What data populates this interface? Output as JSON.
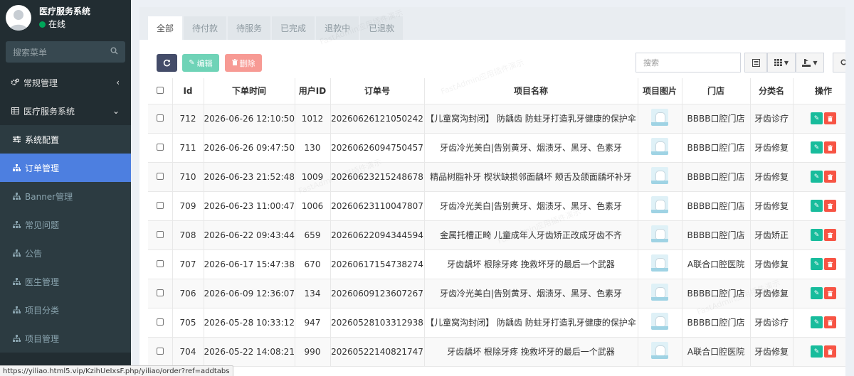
{
  "user": {
    "name": "医疗服务系统",
    "status": "在线"
  },
  "sidebar": {
    "search_placeholder": "搜索菜单",
    "items": [
      {
        "label": "常规管理",
        "icon": "cogs-icon"
      },
      {
        "label": "医疗服务系统",
        "icon": "table-icon"
      },
      {
        "label": "系统配置",
        "icon": "sliders-icon"
      },
      {
        "label": "订单管理",
        "icon": "sitemap-icon"
      },
      {
        "label": "Banner管理",
        "icon": "sitemap-icon"
      },
      {
        "label": "常见问题",
        "icon": "sitemap-icon"
      },
      {
        "label": "公告",
        "icon": "sitemap-icon"
      },
      {
        "label": "医生管理",
        "icon": "sitemap-icon"
      },
      {
        "label": "项目分类",
        "icon": "sitemap-icon"
      },
      {
        "label": "项目管理",
        "icon": "sitemap-icon"
      }
    ]
  },
  "tabs": [
    "全部",
    "待付款",
    "待服务",
    "已完成",
    "退款中",
    "已退款"
  ],
  "toolbar": {
    "edit_label": "编辑",
    "delete_label": "删除",
    "search_placeholder": "搜索"
  },
  "table": {
    "headers": [
      "Id",
      "下单时间",
      "用户ID",
      "订单号",
      "项目名称",
      "项目图片",
      "门店",
      "分类名",
      "操作"
    ],
    "rows": [
      {
        "id": "712",
        "time": "2026-06-26 12:10:50",
        "uid": "1012",
        "order_no": "20260626121050242",
        "project": "【儿童窝沟封闭】 防龋齿 防蛀牙打造乳牙健康的保护伞",
        "store": "BBBB口腔门店",
        "category": "牙齿诊疗"
      },
      {
        "id": "711",
        "time": "2026-06-26 09:47:50",
        "uid": "130",
        "order_no": "20260626094750457",
        "project": "牙齿冷光美白|告别黄牙、烟渍牙、黑牙、色素牙",
        "store": "BBBB口腔门店",
        "category": "牙齿修复"
      },
      {
        "id": "710",
        "time": "2026-06-23 21:52:48",
        "uid": "1009",
        "order_no": "20260623215248678",
        "project": "精品树脂补牙 楔状缺损邻面龋坏 颊舌及颌面龋坏补牙",
        "store": "BBBB口腔门店",
        "category": "牙齿修复"
      },
      {
        "id": "709",
        "time": "2026-06-23 11:00:47",
        "uid": "1006",
        "order_no": "20260623110047807",
        "project": "牙齿冷光美白|告别黄牙、烟渍牙、黑牙、色素牙",
        "store": "BBBB口腔门店",
        "category": "牙齿修复"
      },
      {
        "id": "708",
        "time": "2026-06-22 09:43:44",
        "uid": "659",
        "order_no": "20260622094344594",
        "project": "金属托槽正畸 儿童成年人牙齿矫正改成牙齿不齐",
        "store": "BBBB口腔门店",
        "category": "牙齿矫正"
      },
      {
        "id": "707",
        "time": "2026-06-17 15:47:38",
        "uid": "670",
        "order_no": "20260617154738274",
        "project": "牙齿龋坏 根除牙疼 挽救坏牙的最后一个武器",
        "store": "A联合口腔医院",
        "category": "牙齿修复"
      },
      {
        "id": "706",
        "time": "2026-06-09 12:36:07",
        "uid": "134",
        "order_no": "20260609123607267",
        "project": "牙齿冷光美白|告别黄牙、烟渍牙、黑牙、色素牙",
        "store": "BBBB口腔门店",
        "category": "牙齿修复"
      },
      {
        "id": "705",
        "time": "2026-05-28 10:33:12",
        "uid": "947",
        "order_no": "20260528103312938",
        "project": "【儿童窝沟封闭】 防龋齿 防蛀牙打造乳牙健康的保护伞",
        "store": "BBBB口腔门店",
        "category": "牙齿诊疗"
      },
      {
        "id": "704",
        "time": "2026-05-22 14:08:21",
        "uid": "990",
        "order_no": "20260522140821747",
        "project": "牙齿龋坏 根除牙疼 挽救坏牙的最后一个武器",
        "store": "A联合口腔医院",
        "category": "牙齿修复"
      }
    ]
  },
  "status_url": "https://yiliao.html5.vip/KzihUeIxsF.php/yiliao/order?ref=addtabs",
  "watermark_text": "FastAdmin应用插件演示",
  "colors": {
    "sidebar_bg": "#222d32",
    "active": "#4d7fe0",
    "edit": "#18bc9c",
    "delete": "#f75444"
  }
}
